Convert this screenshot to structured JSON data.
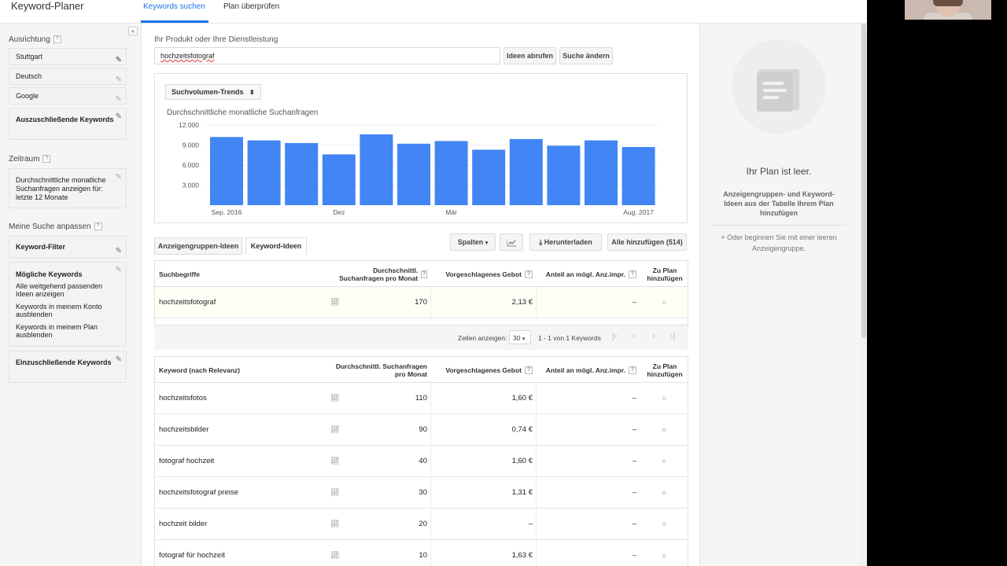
{
  "app": {
    "title": "Keyword-Planer",
    "tabs": [
      "Keywords suchen",
      "Plan überprüfen"
    ]
  },
  "sidebar": {
    "collapse": "«",
    "targeting_label": "Ausrichtung",
    "help": "?",
    "targeting": [
      "Stuttgart",
      "Deutsch",
      "Google"
    ],
    "negative_keywords": "Auszuschließende Keywords",
    "date_range_label": "Zeitraum",
    "date_range_value": "Durchschnittliche monatliche Suchanfragen anzeigen für: letzte 12 Monate",
    "customize_label": "Meine Suche anpassen",
    "keyword_filter": "Keyword-Filter",
    "keyword_options_title": "Mögliche Keywords",
    "keyword_options": [
      "Alle weitgehend passenden Ideen anzeigen",
      "Keywords in meinem Konto ausblenden",
      "Keywords in meinem Plan ausblenden"
    ],
    "include_keywords": "Einzuschließende Keywords"
  },
  "search": {
    "label": "Ihr Produkt oder Ihre Dienstleistung",
    "value": "hochzeitsfotograf",
    "get_ideas": "Ideen abrufen",
    "modify_search": "Suche ändern"
  },
  "chart_controls": {
    "dropdown": "Suchvolumen-Trends",
    "dropdown_icon": "updown-arrows-icon"
  },
  "chart_data": {
    "type": "bar",
    "title": "Durchschnittliche monatliche Suchanfragen",
    "categories": [
      "Sep. 2016",
      "Okt. 2016",
      "Nov. 2016",
      "Dez",
      "Jan. 2017",
      "Feb. 2017",
      "Mär",
      "Apr. 2017",
      "Mai 2017",
      "Jun. 2017",
      "Jul. 2017",
      "Aug. 2017"
    ],
    "x_tick_labels": [
      "Sep. 2016",
      "Dez",
      "Mär",
      "Aug. 2017"
    ],
    "values": [
      10200,
      9700,
      9300,
      7600,
      10600,
      9200,
      9600,
      8300,
      9900,
      8900,
      9700,
      8700
    ],
    "yticks": [
      "3.000",
      "6.000",
      "9.000",
      "12.000"
    ],
    "ylim": [
      0,
      12000
    ],
    "color": "#4285f4"
  },
  "result_tabs": [
    "Anzeigengruppen-Ideen",
    "Keyword-Ideen"
  ],
  "toolbar": {
    "columns": "Spalten",
    "chart_icon": "line-chart-icon",
    "download": "Herunterladen",
    "add_all": "Alle hinzufügen (514)"
  },
  "search_terms_table": {
    "headers": [
      "Suchbegriffe",
      "Durchschnittl. Suchanfragen pro Monat",
      "Vorgeschlagenes Gebot",
      "Anteil an mögl. Anz.impr.",
      "Zu Plan hinzufügen"
    ],
    "rows": [
      {
        "keyword": "hochzeitsfotograf",
        "searches": "170",
        "bid": "2,13 €",
        "share": "–"
      }
    ]
  },
  "pager": {
    "rows_label": "Zeilen anzeigen:",
    "rows_value": "30",
    "range": "1 - 1 von 1 Keywords"
  },
  "ideas_table": {
    "headers": [
      "Keyword (nach Relevanz)",
      "Durchschnittl. Suchanfragen pro Monat",
      "Vorgeschlagenes Gebot",
      "Anteil an mögl. Anz.impr.",
      "Zu Plan hinzufügen"
    ],
    "rows": [
      {
        "keyword": "hochzeitsfotos",
        "searches": "110",
        "bid": "1,60 €",
        "share": "–"
      },
      {
        "keyword": "hochzeitsbilder",
        "searches": "90",
        "bid": "0,74 €",
        "share": "–"
      },
      {
        "keyword": "fotograf hochzeit",
        "searches": "40",
        "bid": "1,60 €",
        "share": "–"
      },
      {
        "keyword": "hochzeitsfotograf preise",
        "searches": "30",
        "bid": "1,31 €",
        "share": "–"
      },
      {
        "keyword": "hochzeit bilder",
        "searches": "20",
        "bid": "–",
        "share": "–"
      },
      {
        "keyword": "fotograf für hochzeit",
        "searches": "10",
        "bid": "1,63 €",
        "share": "–"
      }
    ]
  },
  "plan_panel": {
    "empty_title": "Ihr Plan ist leer.",
    "empty_desc": "Anzeigengruppen- und Keyword-Ideen aus der Tabelle Ihrem Plan hinzufügen",
    "new_group": "+ Oder beginnen Sie mit einer leeren Anzeigengruppe."
  }
}
